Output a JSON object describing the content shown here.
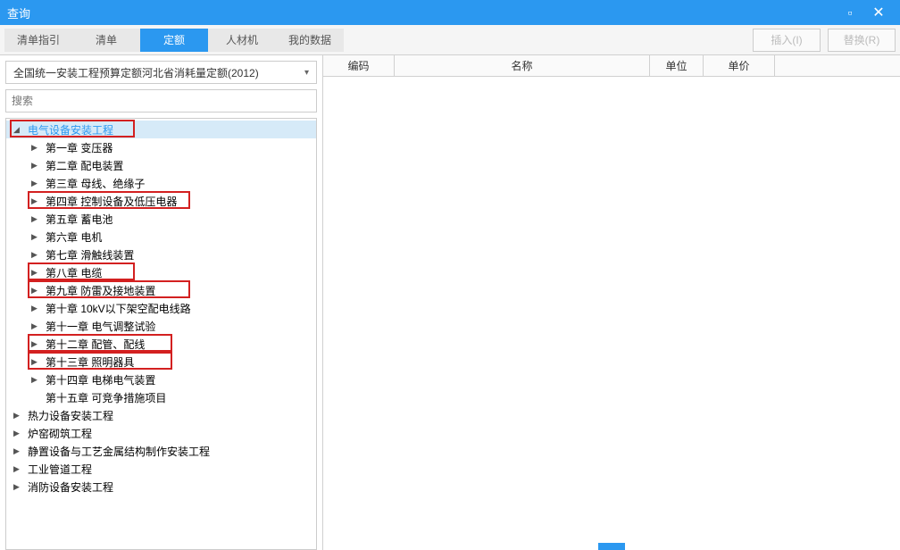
{
  "window": {
    "title": "查询",
    "min": "▢",
    "close": "✕"
  },
  "tabs": [
    "清单指引",
    "清单",
    "定额",
    "人材机",
    "我的数据"
  ],
  "activeTab": 2,
  "actions": {
    "insert": "插入(I)",
    "replace": "替换(R)"
  },
  "dropdown": "全国统一安装工程预算定额河北省消耗量定额(2012)",
  "searchPlaceholder": "搜索",
  "gridHeaders": {
    "code": "编码",
    "name": "名称",
    "unit": "单位",
    "price": "单价"
  },
  "tree": [
    {
      "level": 1,
      "expanded": true,
      "label": "电气设备安装工程",
      "highlighted": true,
      "selected": true,
      "red": true,
      "hasChild": true
    },
    {
      "level": 2,
      "label": "第一章 变压器",
      "hasChild": true
    },
    {
      "level": 2,
      "label": "第二章 配电装置",
      "hasChild": true
    },
    {
      "level": 2,
      "label": "第三章 母线、绝缘子",
      "hasChild": true
    },
    {
      "level": 2,
      "label": "第四章 控制设备及低压电器",
      "red": true,
      "hasChild": true
    },
    {
      "level": 2,
      "label": "第五章 蓄电池",
      "hasChild": true
    },
    {
      "level": 2,
      "label": "第六章 电机",
      "hasChild": true
    },
    {
      "level": 2,
      "label": "第七章 滑触线装置",
      "hasChild": true
    },
    {
      "level": 2,
      "label": "第八章 电缆",
      "red": true,
      "hasChild": true
    },
    {
      "level": 2,
      "label": "第九章 防雷及接地装置",
      "red": true,
      "hasChild": true
    },
    {
      "level": 2,
      "label": "第十章 10kV以下架空配电线路",
      "hasChild": true
    },
    {
      "level": 2,
      "label": "第十一章 电气调整试验",
      "hasChild": true
    },
    {
      "level": 2,
      "label": "第十二章 配管、配线",
      "red": true,
      "hasChild": true
    },
    {
      "level": 2,
      "label": "第十三章 照明器具",
      "red": true,
      "hasChild": true
    },
    {
      "level": 2,
      "label": "第十四章 电梯电气装置",
      "hasChild": true
    },
    {
      "level": 2,
      "label": "第十五章 可竞争措施项目",
      "hasChild": false
    },
    {
      "level": 1,
      "label": "热力设备安装工程",
      "hasChild": true
    },
    {
      "level": 1,
      "label": "炉窑砌筑工程",
      "hasChild": true
    },
    {
      "level": 1,
      "label": "静置设备与工艺金属结构制作安装工程",
      "hasChild": true
    },
    {
      "level": 1,
      "label": "工业管道工程",
      "hasChild": true
    },
    {
      "level": 1,
      "label": "消防设备安装工程",
      "hasChild": true
    }
  ]
}
